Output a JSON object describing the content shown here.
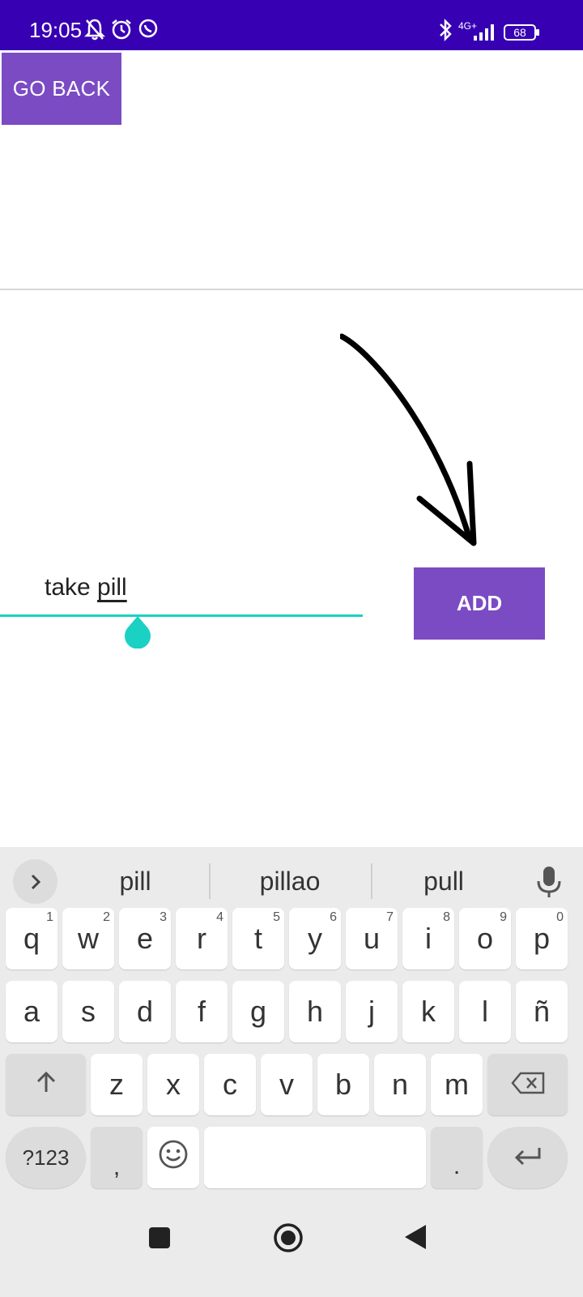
{
  "status_bar": {
    "time": "19:05",
    "network": "4G+",
    "battery": "68",
    "left_icons": [
      "bell-off-icon",
      "alarm-icon",
      "whatsapp-icon"
    ],
    "right_icons": [
      "bluetooth-icon",
      "signal-icon",
      "battery-icon"
    ]
  },
  "toolbar": {
    "go_back_label": "GO BACK"
  },
  "form": {
    "input_prefix": "take ",
    "input_composing": "pill",
    "add_label": "ADD",
    "accent_color": "#1ad1c4",
    "button_color": "#7b4bc4"
  },
  "keyboard": {
    "suggestions": [
      "pill",
      "pillao",
      "pull"
    ],
    "row1": [
      {
        "k": "q",
        "h": "1"
      },
      {
        "k": "w",
        "h": "2"
      },
      {
        "k": "e",
        "h": "3"
      },
      {
        "k": "r",
        "h": "4"
      },
      {
        "k": "t",
        "h": "5"
      },
      {
        "k": "y",
        "h": "6"
      },
      {
        "k": "u",
        "h": "7"
      },
      {
        "k": "i",
        "h": "8"
      },
      {
        "k": "o",
        "h": "9"
      },
      {
        "k": "p",
        "h": "0"
      }
    ],
    "row2": [
      "a",
      "s",
      "d",
      "f",
      "g",
      "h",
      "j",
      "k",
      "l",
      "ñ"
    ],
    "row3": [
      "z",
      "x",
      "c",
      "v",
      "b",
      "n",
      "m"
    ],
    "symbols_label": "?123",
    "comma_label": ",",
    "period_label": "."
  }
}
